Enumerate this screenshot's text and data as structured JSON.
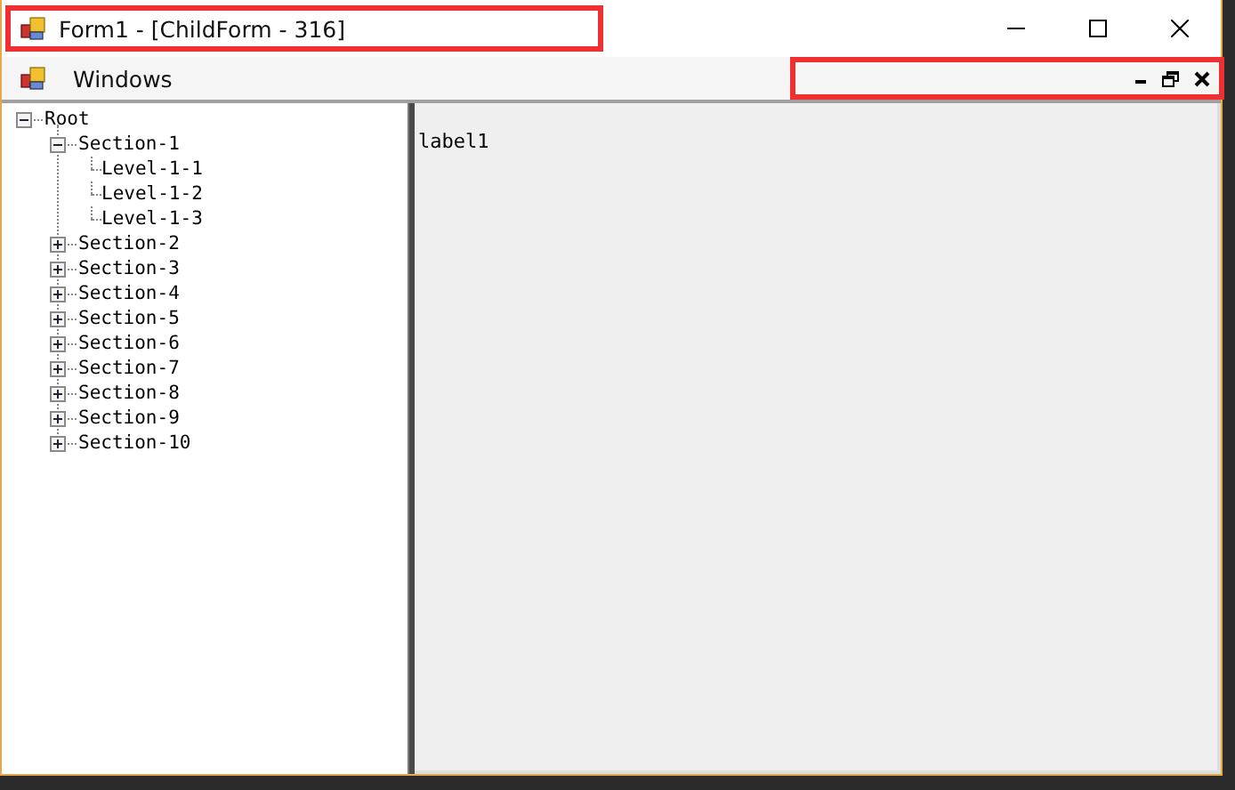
{
  "window": {
    "title": "Form1 - [ChildForm - 316]",
    "title_highlighted": true
  },
  "menu_bar": {
    "items": [
      {
        "label": "Windows"
      }
    ],
    "mdi_controls_highlighted": true
  },
  "tree": {
    "nodes": [
      {
        "label": "Root",
        "expanded": true,
        "children": [
          {
            "label": "Section-1",
            "expanded": true,
            "children": [
              {
                "label": "Level-1-1"
              },
              {
                "label": "Level-1-2"
              },
              {
                "label": "Level-1-3"
              }
            ]
          },
          {
            "label": "Section-2",
            "expanded": false
          },
          {
            "label": "Section-3",
            "expanded": false
          },
          {
            "label": "Section-4",
            "expanded": false
          },
          {
            "label": "Section-5",
            "expanded": false
          },
          {
            "label": "Section-6",
            "expanded": false
          },
          {
            "label": "Section-7",
            "expanded": false
          },
          {
            "label": "Section-8",
            "expanded": false
          },
          {
            "label": "Section-9",
            "expanded": false
          },
          {
            "label": "Section-10",
            "expanded": false
          }
        ]
      }
    ]
  },
  "content": {
    "label": "label1"
  }
}
